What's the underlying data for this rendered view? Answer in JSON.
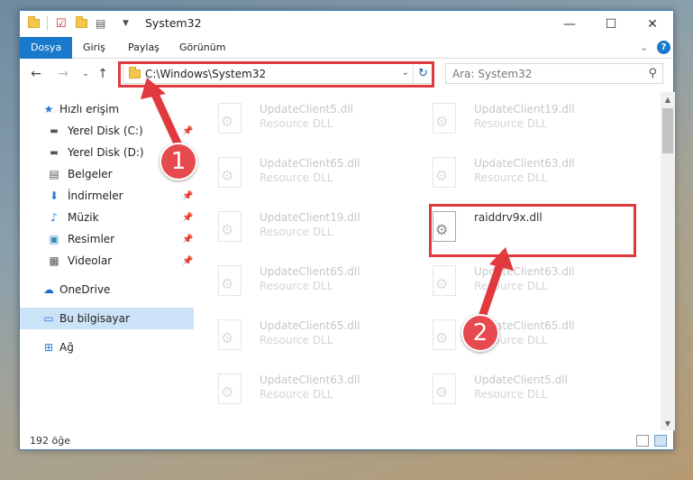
{
  "window": {
    "title": "System32",
    "controls": {
      "minimize": "—",
      "maximize": "☐",
      "close": "✕"
    }
  },
  "ribbon": {
    "tabs": [
      "Dosya",
      "Giriş",
      "Paylaş",
      "Görünüm"
    ],
    "expand": "⌄",
    "help": "?"
  },
  "address": {
    "path": "C:\\Windows\\System32",
    "search_placeholder": "Ara: System32"
  },
  "navigation": {
    "items": [
      {
        "label": "Hızlı erişim",
        "icon": "star-icon",
        "pinned": false
      },
      {
        "label": "Yerel Disk (C:)",
        "icon": "drive-icon",
        "pinned": true
      },
      {
        "label": "Yerel Disk (D:)",
        "icon": "drive-icon",
        "pinned": true
      },
      {
        "label": "Belgeler",
        "icon": "documents-icon",
        "pinned": true
      },
      {
        "label": "İndirmeler",
        "icon": "download-icon",
        "pinned": true
      },
      {
        "label": "Müzik",
        "icon": "music-icon",
        "pinned": true
      },
      {
        "label": "Resimler",
        "icon": "pictures-icon",
        "pinned": true
      },
      {
        "label": "Videolar",
        "icon": "videos-icon",
        "pinned": true
      },
      {
        "label": "OneDrive",
        "icon": "cloud-icon",
        "pinned": false
      },
      {
        "label": "Bu bilgisayar",
        "icon": "computer-icon",
        "pinned": false
      },
      {
        "label": "Ağ",
        "icon": "network-icon",
        "pinned": false
      }
    ]
  },
  "files": [
    {
      "name": "UpdateClient5.dll",
      "type": "Resource DLL"
    },
    {
      "name": "UpdateClient19.dll",
      "type": "Resource DLL"
    },
    {
      "name": "UpdateClient65.dll",
      "type": "Resource DLL"
    },
    {
      "name": "UpdateClient63.dll",
      "type": "Resource DLL"
    },
    {
      "name": "UpdateClient19.dll",
      "type": "Resource DLL"
    },
    {
      "name": "raiddrv9x.dll",
      "type": ""
    },
    {
      "name": "UpdateClient65.dll",
      "type": "Resource DLL"
    },
    {
      "name": "UpdateClient63.dll",
      "type": "Resource DLL"
    },
    {
      "name": "UpdateClient65.dll",
      "type": "Resource DLL"
    },
    {
      "name": "UpdateClient65.dll",
      "type": "Resource DLL"
    },
    {
      "name": "UpdateClient63.dll",
      "type": "Resource DLL"
    },
    {
      "name": "UpdateClient5.dll",
      "type": "Resource DLL"
    }
  ],
  "status": {
    "count": "192 öğe"
  },
  "annotations": {
    "step1": "1",
    "step2": "2",
    "color": "#e0393e"
  }
}
